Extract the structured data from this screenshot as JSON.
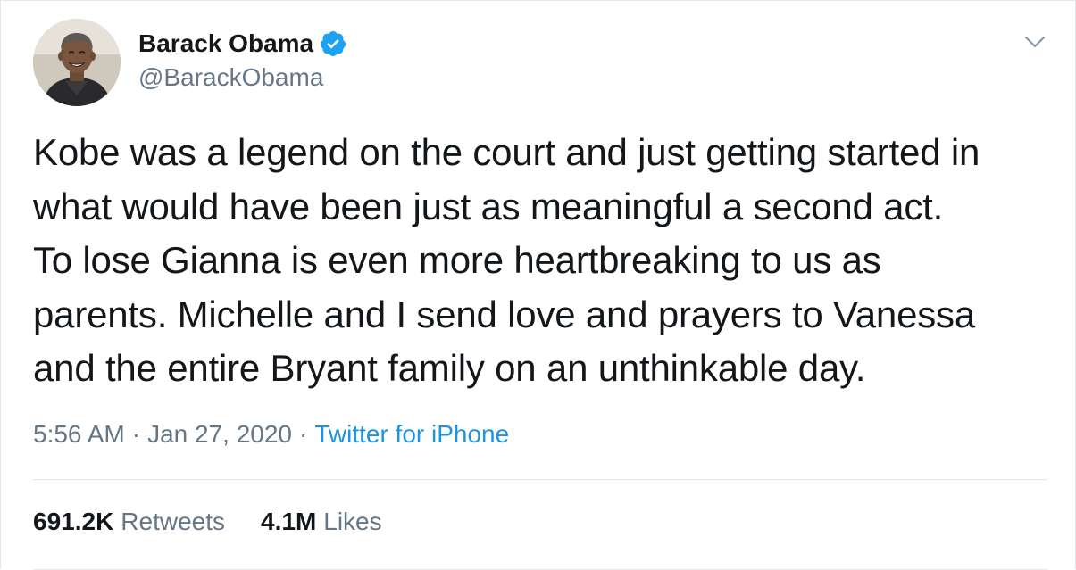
{
  "author": {
    "display_name": "Barack Obama",
    "handle": "@BarackObama",
    "verified": true,
    "avatar_icon": "profile-photo"
  },
  "tweet": {
    "lines": [
      "Kobe was a legend on the court and just getting started in",
      "what would have been just as meaningful a second act.",
      "To lose Gianna is even more heartbreaking to us as",
      "parents. Michelle and I send love and prayers to Vanessa",
      "and the entire Bryant family on an unthinkable day."
    ]
  },
  "meta": {
    "time": "5:56 AM",
    "separator": "·",
    "date": "Jan 27, 2020",
    "source": "Twitter for iPhone"
  },
  "stats": {
    "retweets_count": "691.2K",
    "retweets_label": "Retweets",
    "likes_count": "4.1M",
    "likes_label": "Likes"
  },
  "colors": {
    "text": "#14171a",
    "muted": "#657786",
    "link": "#1b95e0",
    "verified": "#1da1f2",
    "border": "#e1e8ed"
  },
  "icons": {
    "verified": "verified-badge-icon",
    "menu": "chevron-down-icon"
  }
}
